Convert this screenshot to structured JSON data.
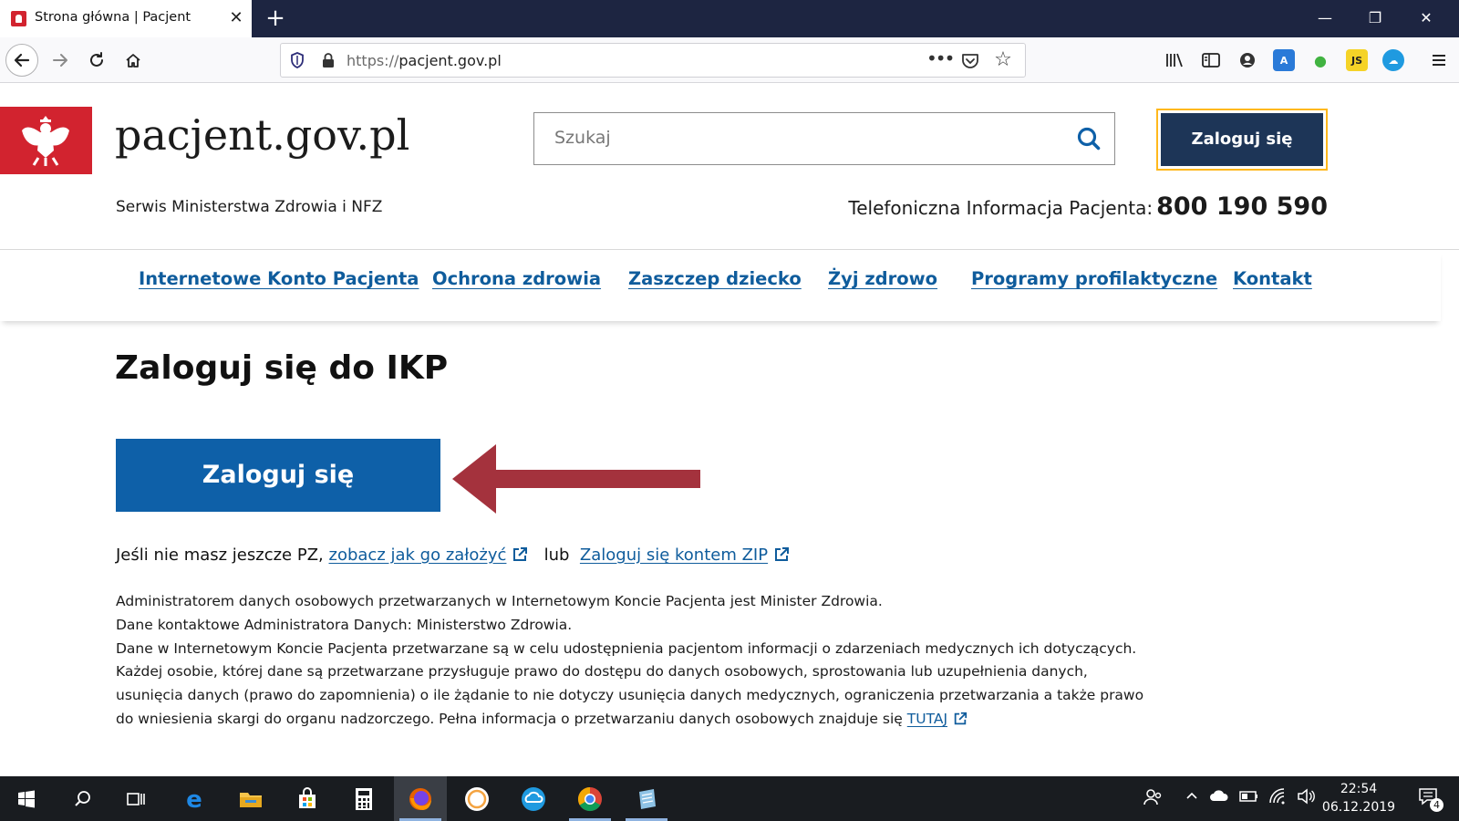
{
  "browser": {
    "tab_title": "Strona główna | Pacjent",
    "url_proto": "https://",
    "url_host": "pacjent.gov.pl",
    "ext_js_label": "JS"
  },
  "site": {
    "title": "pacjent.gov.pl",
    "subtitle": "Serwis Ministerstwa Zdrowia i NFZ",
    "search_placeholder": "Szukaj",
    "login_top_label": "Zaloguj się",
    "phone_label": "Telefoniczna Informacja Pacjenta:",
    "phone_number": "800 190 590"
  },
  "nav": {
    "items": [
      {
        "label": "Internetowe Konto Pacjenta"
      },
      {
        "label": "Ochrona zdrowia"
      },
      {
        "label": "Zaszczep dziecko"
      },
      {
        "label": "Żyj zdrowo"
      },
      {
        "label": "Programy profilaktyczne"
      },
      {
        "label": "Kontakt"
      }
    ]
  },
  "main": {
    "heading": "Zaloguj się do IKP",
    "login_button": "Zaloguj się",
    "info_prefix": "Jeśli nie masz jeszcze PZ,",
    "info_link1": "zobacz jak go założyć",
    "info_or": "lub",
    "info_link2": "Zaloguj się kontem ZIP",
    "legal": [
      "Administratorem danych osobowych przetwarzanych w Internetowym Koncie Pacjenta jest Minister Zdrowia.",
      "Dane kontaktowe Administratora Danych: Ministerstwo Zdrowia.",
      "Dane w Internetowym Koncie Pacjenta przetwarzane są w celu udostępnienia pacjentom informacji o zdarzeniach medycznych ich dotyczących.",
      "Każdej osobie, której dane są przetwarzane przysługuje prawo do dostępu do danych osobowych, sprostowania lub uzupełnienia danych,",
      "usunięcia danych (prawo do zapomnienia) o ile żądanie to nie dotyczy usunięcia danych medycznych, ograniczenia przetwarzania a także prawo",
      "do wniesienia skargi do organu nadzorczego. Pełna informacja o przetwarzaniu danych osobowych znajduje się"
    ],
    "legal_link": "TUTAJ",
    "arrow_color": "#a4323d"
  },
  "taskbar": {
    "time": "22:54",
    "date": "06.12.2019",
    "notification_count": "4"
  },
  "colors": {
    "brand_red": "#d2232f",
    "navy": "#1d3557",
    "primary_blue": "#0e60a8",
    "link_blue": "#0f5c9c",
    "focus_yellow": "#ffb81c"
  }
}
